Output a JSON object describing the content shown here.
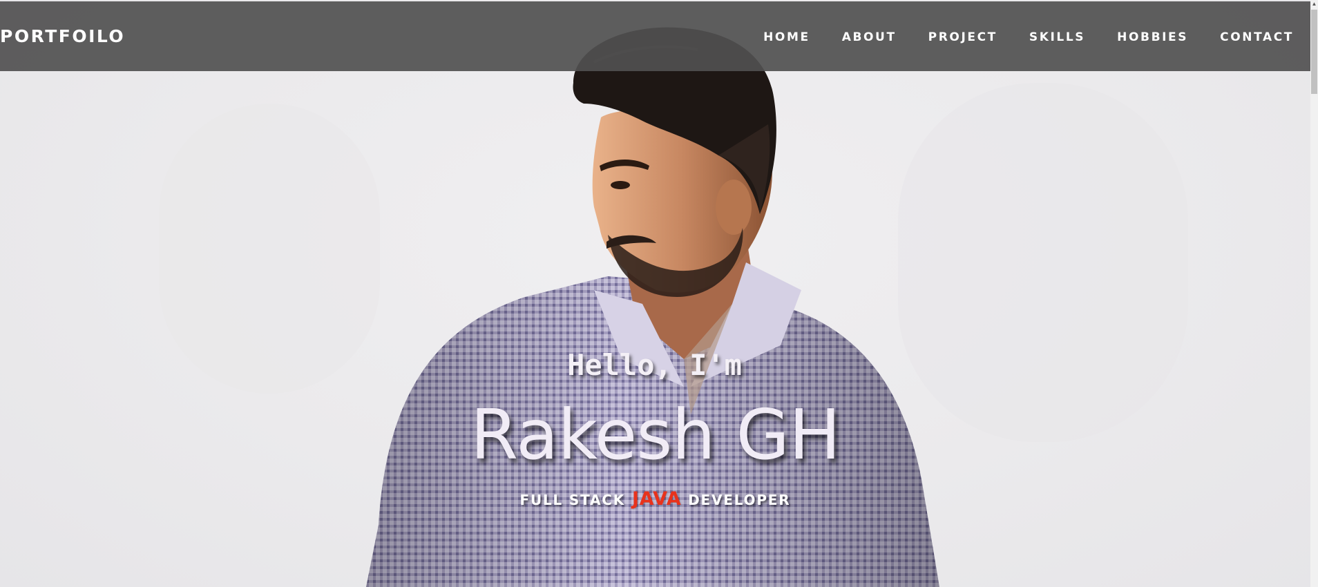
{
  "navbar": {
    "brand": "PORTFOILO",
    "links": [
      "HOME",
      "ABOUT",
      "PROJECT",
      "SKILLS",
      "HOBBIES",
      "CONTACT"
    ]
  },
  "hero": {
    "greeting": "Hello, I'm",
    "name": "Rakesh GH",
    "tagline_before": "FULL STACK",
    "tagline_accent": "JAVA",
    "tagline_after": "DEVELOPER"
  },
  "colors": {
    "navbar_bg": "#505050",
    "accent": "#e8321c",
    "background": "#ececec",
    "shirt": "#9a94b8"
  }
}
